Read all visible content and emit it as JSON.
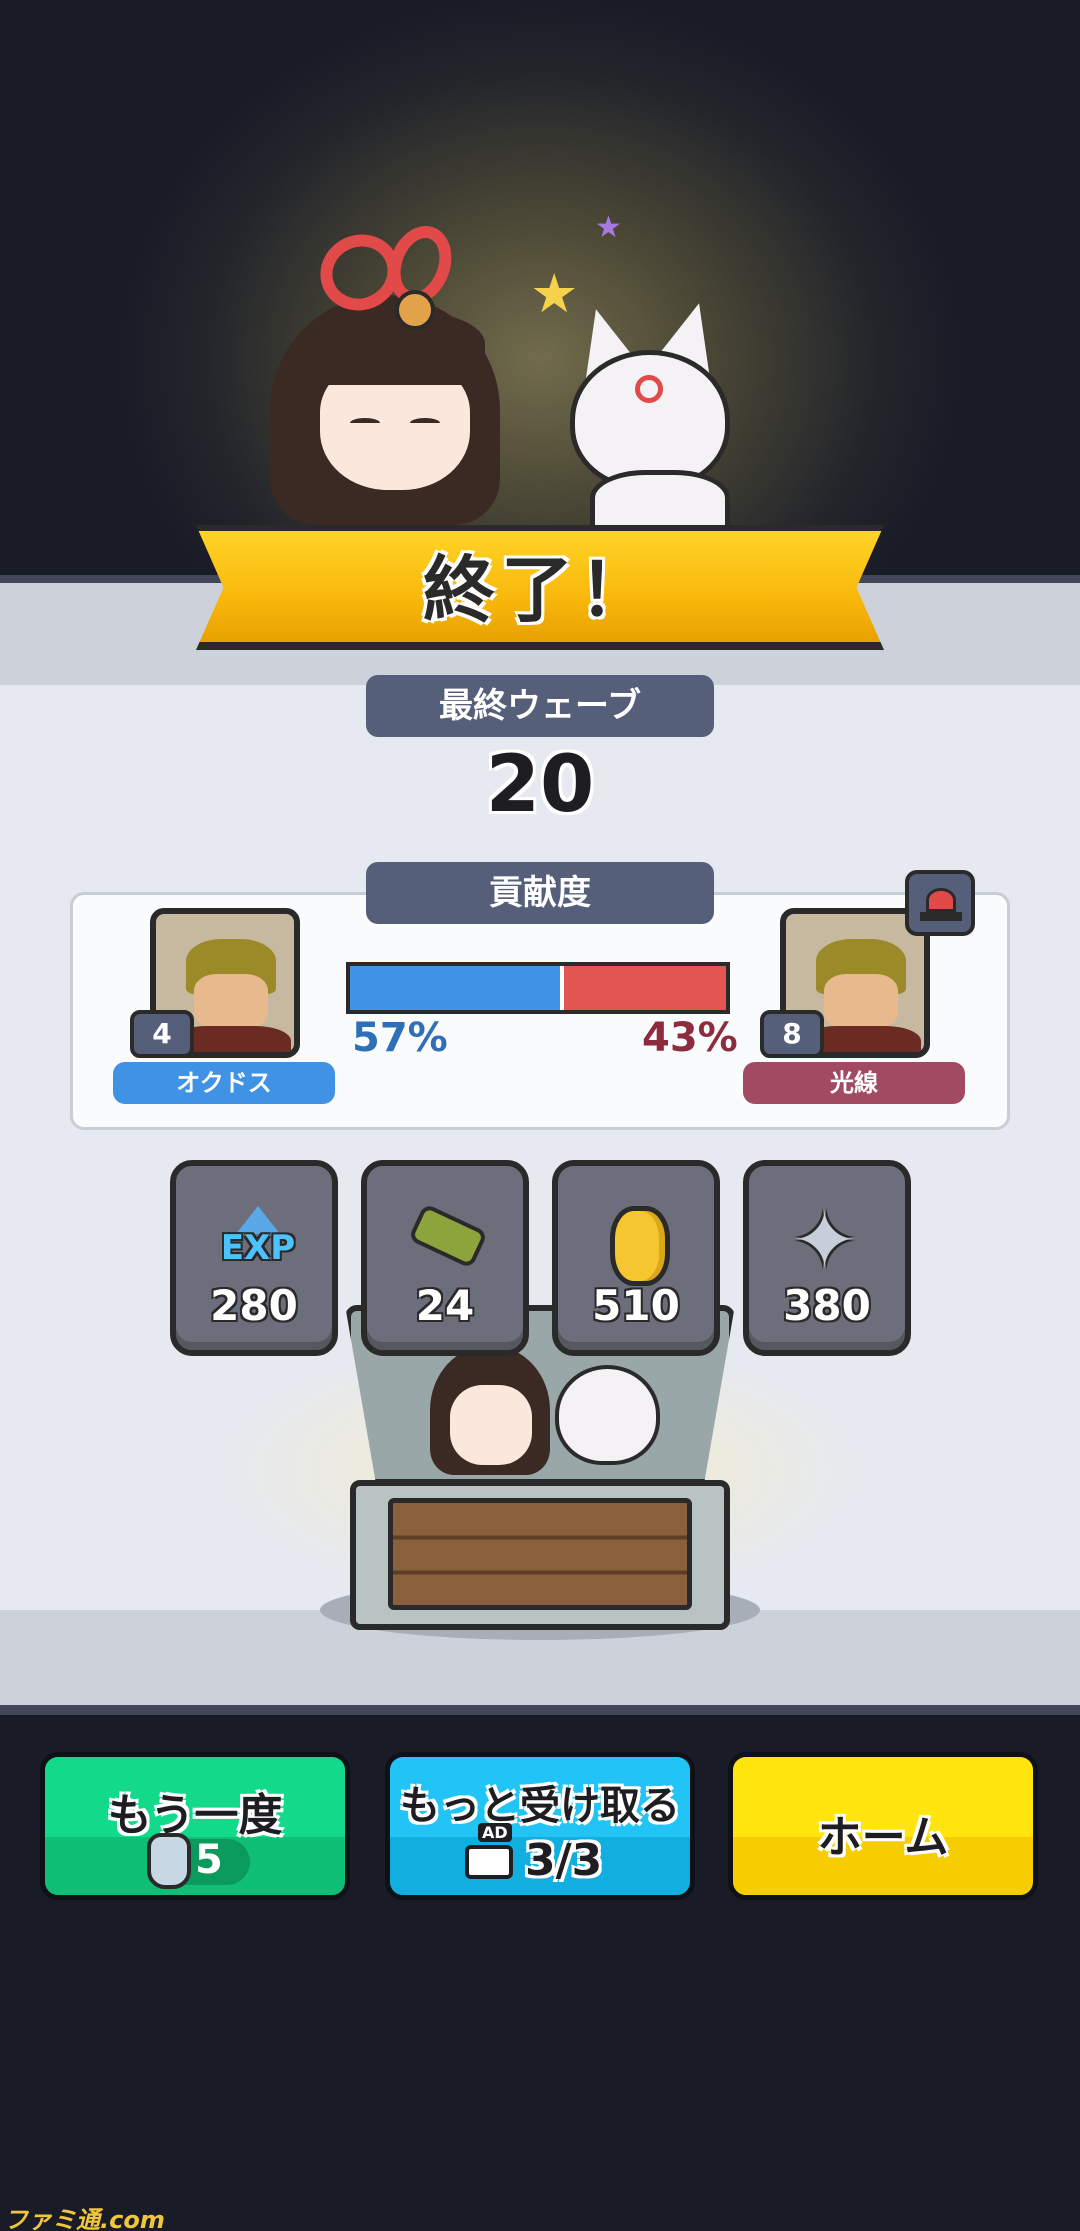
{
  "result": {
    "title": "終了！",
    "final_wave_label": "最終ウェーブ",
    "final_wave_value": "20"
  },
  "contribution": {
    "label": "貢献度",
    "left_player": {
      "level": "4",
      "name": "オクドス",
      "percent": "57%",
      "share": 0.57,
      "color": "#4092e4"
    },
    "right_player": {
      "level": "8",
      "name": "光線",
      "percent": "43%",
      "share": 0.43,
      "color": "#a34a63"
    },
    "siren_icon": "alarm-siren-icon"
  },
  "rewards": [
    {
      "icon": "exp-icon",
      "icon_text": "EXP",
      "value": "280"
    },
    {
      "icon": "scroll-icon",
      "value": "24"
    },
    {
      "icon": "gold-coin-icon",
      "value": "510"
    },
    {
      "icon": "shuriken-icon",
      "value": "380"
    }
  ],
  "buttons": {
    "retry": {
      "label": "もう一度",
      "cost_icon": "bottle-icon",
      "cost": "5",
      "color": "#13d98a"
    },
    "receive_more": {
      "label": "もっと受け取る",
      "ad_tag": "AD",
      "ad_icon": "video-camera-icon",
      "count": "3/3",
      "color": "#22c4f5"
    },
    "home": {
      "label": "ホーム",
      "color": "#ffe40d"
    }
  },
  "watermark": "ファミ通.com"
}
